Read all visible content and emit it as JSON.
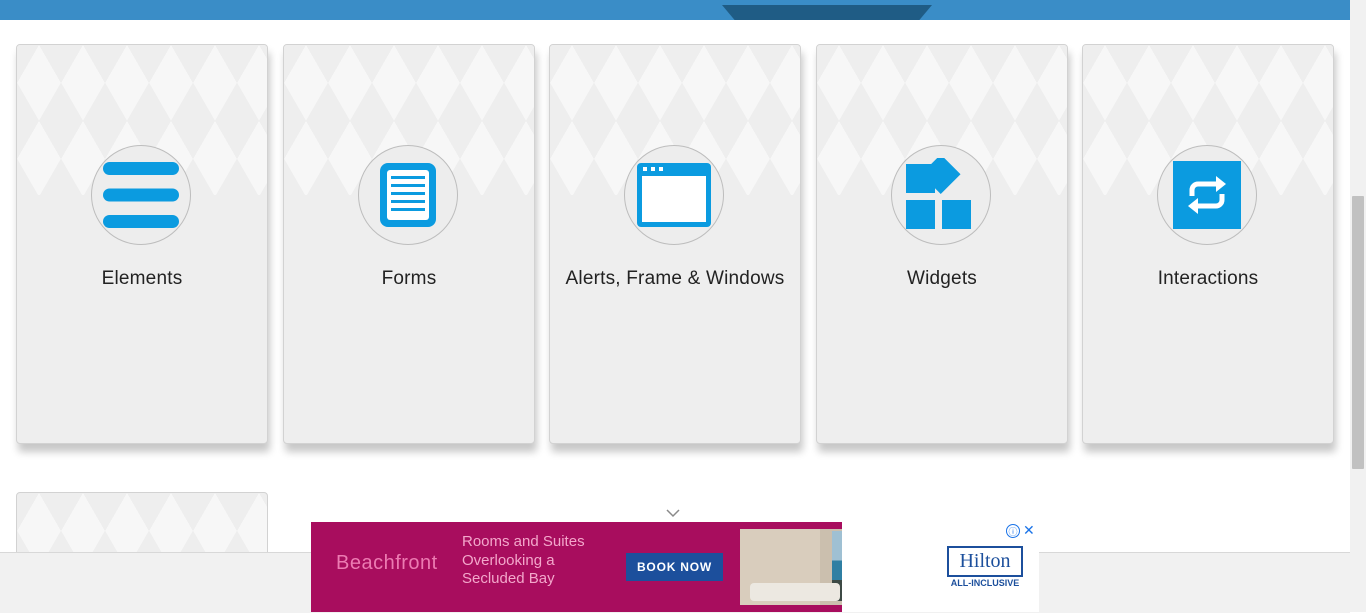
{
  "colors": {
    "banner": "#3a8dc7",
    "banner_tab": "#1f5c85",
    "icon_blue": "#0b9be0",
    "card_bg": "#eeeeee",
    "ad_bg": "#a80d5e"
  },
  "cards": [
    {
      "title": "Elements",
      "icon": "hamburger-menu-icon"
    },
    {
      "title": "Forms",
      "icon": "document-form-icon"
    },
    {
      "title": "Alerts, Frame & Windows",
      "icon": "browser-window-icon"
    },
    {
      "title": "Widgets",
      "icon": "widget-blocks-icon"
    },
    {
      "title": "Interactions",
      "icon": "repeat-arrows-icon"
    }
  ],
  "ad": {
    "brand": "Beachfront",
    "tagline": "Rooms and Suites Overlooking a Secluded Bay",
    "cta": "BOOK NOW",
    "logo": "Hilton",
    "logo_sub": "ALL-INCLUSIVE",
    "info_icon": "ⓘ",
    "close_icon": "✕"
  }
}
